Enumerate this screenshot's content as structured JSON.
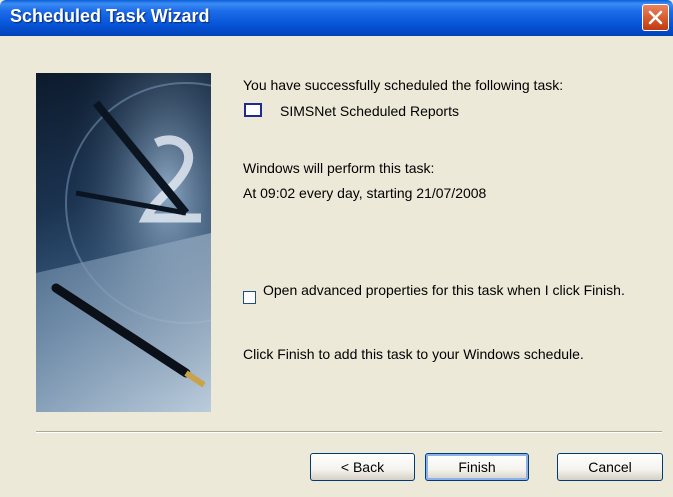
{
  "window": {
    "title": "Scheduled Task Wizard"
  },
  "content": {
    "success_message": "You have successfully scheduled the following task:",
    "task_name": "SIMSNet Scheduled Reports",
    "perform_heading": "Windows will perform this task:",
    "schedule": "At 09:02 every day, starting 21/07/2008",
    "checkbox_label": "Open advanced properties for this task when I click Finish.",
    "checkbox_checked": false,
    "finish_instruction": "Click Finish to add this task to your Windows schedule."
  },
  "buttons": {
    "back": "< Back",
    "finish": "Finish",
    "cancel": "Cancel"
  },
  "colors": {
    "title_bar": "#0553D6",
    "close_button": "#D65A2E",
    "dialog_bg": "#ECE9D8"
  },
  "icons": {
    "close": "close-x-icon",
    "task": "task-window-icon"
  }
}
